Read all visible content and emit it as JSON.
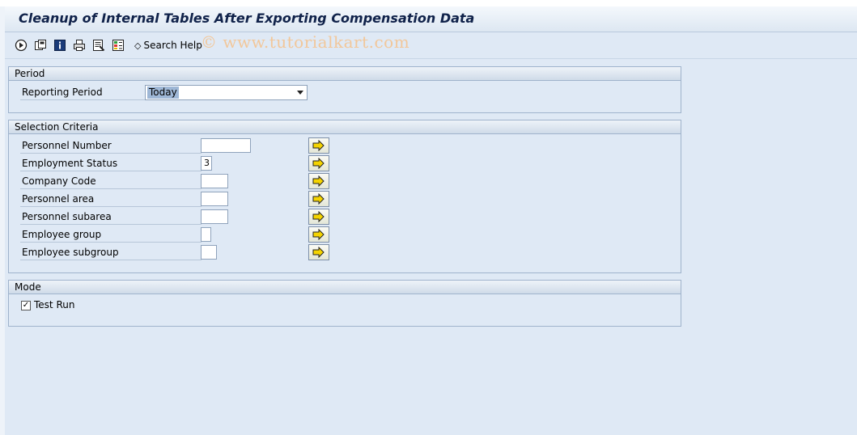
{
  "window": {
    "title": "Cleanup of Internal Tables After Exporting Compensation Data"
  },
  "toolbar": {
    "buttons": [
      {
        "name": "execute-icon"
      },
      {
        "name": "save-variant-icon"
      },
      {
        "name": "info-icon"
      },
      {
        "name": "print-icon"
      },
      {
        "name": "variant-attributes-icon"
      },
      {
        "name": "selection-options-icon"
      }
    ],
    "search_help_label": "Search Help",
    "watermark": "© www.tutorialkart.com"
  },
  "period": {
    "heading": "Period",
    "reporting_period_label": "Reporting Period",
    "reporting_period_value": "Today"
  },
  "selection": {
    "heading": "Selection Criteria",
    "fields": [
      {
        "label": "Personnel Number",
        "value": ""
      },
      {
        "label": "Employment Status",
        "value": "3"
      },
      {
        "label": "Company Code",
        "value": ""
      },
      {
        "label": "Personnel area",
        "value": ""
      },
      {
        "label": "Personnel subarea",
        "value": ""
      },
      {
        "label": "Employee group",
        "value": ""
      },
      {
        "label": "Employee subgroup",
        "value": ""
      }
    ]
  },
  "mode": {
    "heading": "Mode",
    "test_run_label": "Test Run",
    "test_run_checked": true
  },
  "colors": {
    "background": "#dfe9f5",
    "title_text": "#10224a",
    "selected_value": "#9eb7d6",
    "arrow_fill": "#f5d400"
  }
}
